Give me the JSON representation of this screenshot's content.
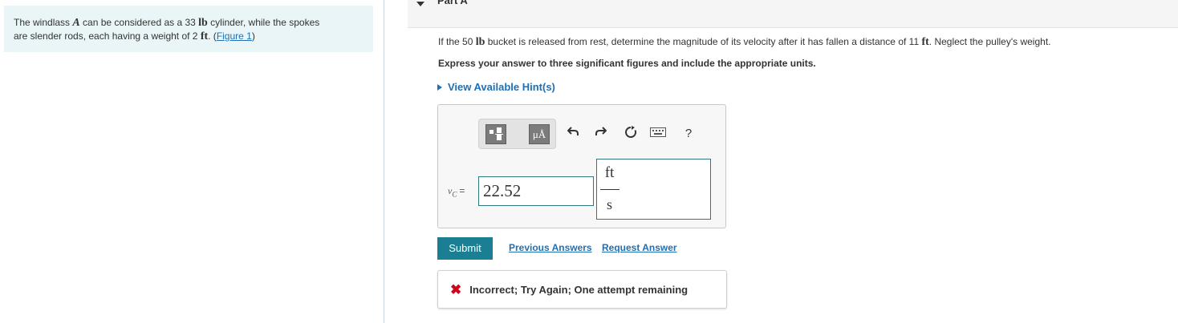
{
  "problem": {
    "text_before_A": "The windlass ",
    "symbol_A": "A",
    "text_after_A": " can be considered as a 33 ",
    "unit_lb": "lb",
    "text_after_lb": " cylinder, while the spokes",
    "line2_start": "are slender rods, each having a weight of 2 ",
    "unit_ft": "ft",
    "line2_sep": ". (",
    "figure_link": "Figure 1",
    "line2_end": ")"
  },
  "part": {
    "title": "Part A"
  },
  "question": {
    "before_lb": "If the 50 ",
    "unit_lb": "lb",
    "middle": " bucket is released from rest, determine the magnitude of its velocity after it has fallen a distance of 11 ",
    "unit_ft": "ft",
    "end": ". Neglect the pulley's weight."
  },
  "instruction": "Express your answer to three significant figures and include the appropriate units.",
  "hints_label": "View Available Hint(s)",
  "toolbar": {
    "units_btn_label": "μÅ",
    "undo_icon": "undo-icon",
    "redo_icon": "redo-icon",
    "reset_icon": "reset-icon",
    "keyboard_icon": "keyboard-icon",
    "help_label": "?"
  },
  "answer": {
    "variable": "vC",
    "var_main": "v",
    "var_sub": "C",
    "equals": "=",
    "value": "22.52",
    "unit_numerator": "ft",
    "unit_denominator": "s"
  },
  "actions": {
    "submit": "Submit",
    "previous_answers": "Previous Answers",
    "request_answer": "Request Answer"
  },
  "feedback": {
    "text": "Incorrect; Try Again; One attempt remaining",
    "color": "#d0021b"
  }
}
